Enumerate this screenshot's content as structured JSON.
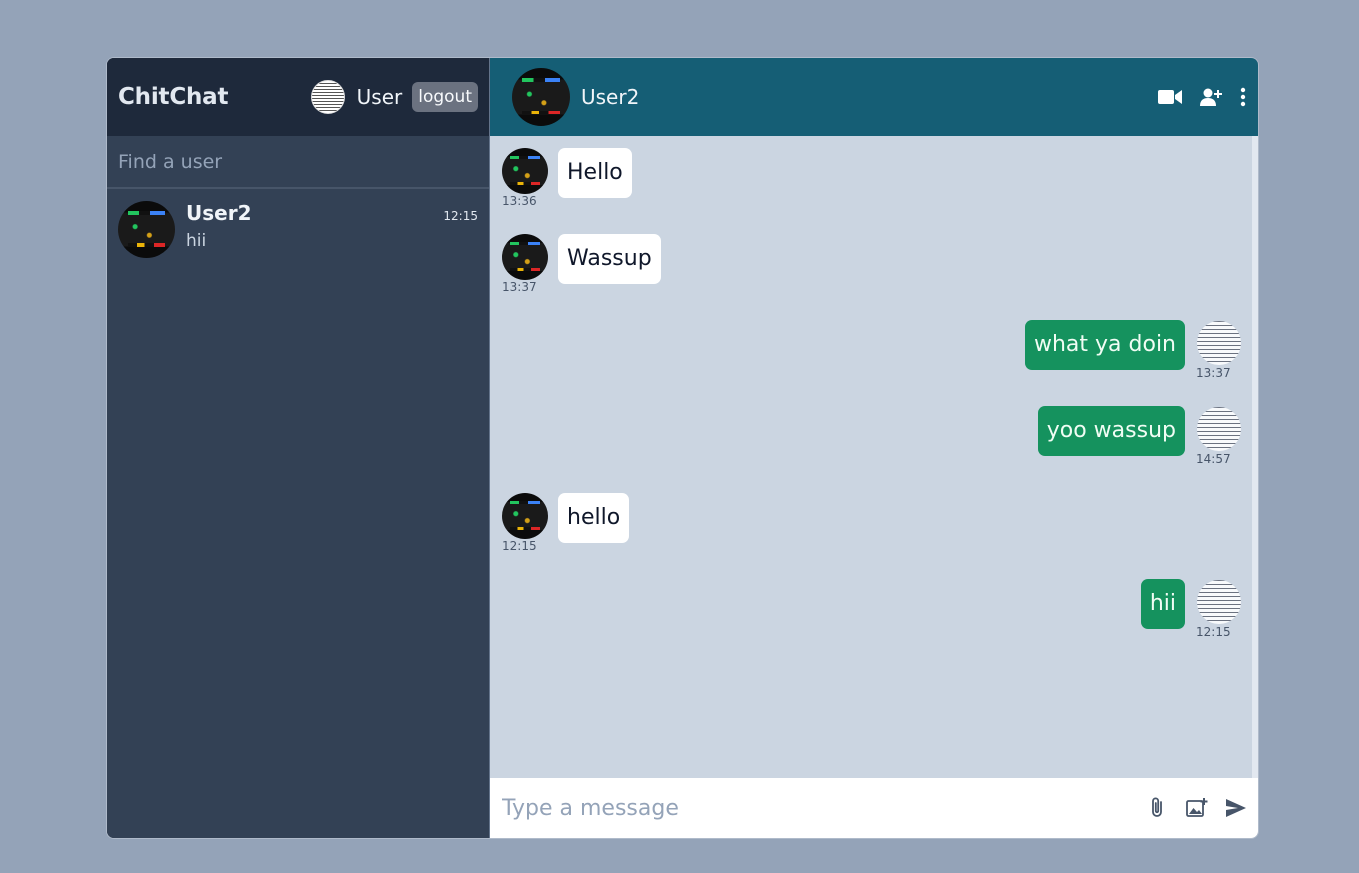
{
  "sidebar": {
    "brand": "ChitChat",
    "current_user": "User",
    "logout_label": "logout",
    "search_placeholder": "Find a user",
    "contacts": [
      {
        "name": "User2",
        "time": "12:15",
        "preview": "hii"
      }
    ]
  },
  "chat": {
    "title": "User2",
    "icons": [
      "video-icon",
      "add-user-icon",
      "more-vertical-icon"
    ],
    "messages": [
      {
        "direction": "in",
        "text": "Hello",
        "time": "13:36"
      },
      {
        "direction": "in",
        "text": "Wassup",
        "time": "13:37"
      },
      {
        "direction": "out",
        "text": "what ya doin",
        "time": "13:37"
      },
      {
        "direction": "out",
        "text": "yoo wassup",
        "time": "14:57"
      },
      {
        "direction": "in",
        "text": "hello",
        "time": "12:15"
      },
      {
        "direction": "out",
        "text": "hii",
        "time": "12:15"
      }
    ],
    "composer_placeholder": "Type a message",
    "composer_icons": [
      "attach-icon",
      "image-upload-icon",
      "send-icon"
    ]
  },
  "colors": {
    "page_bg": "#94a3b8",
    "sidebar_bg": "#334155",
    "sidebar_header_bg": "#1e293b",
    "chat_header_bg": "#155e75",
    "chat_bg": "#cbd5e1",
    "outgoing_bubble": "#15925e",
    "incoming_bubble": "#ffffff"
  }
}
